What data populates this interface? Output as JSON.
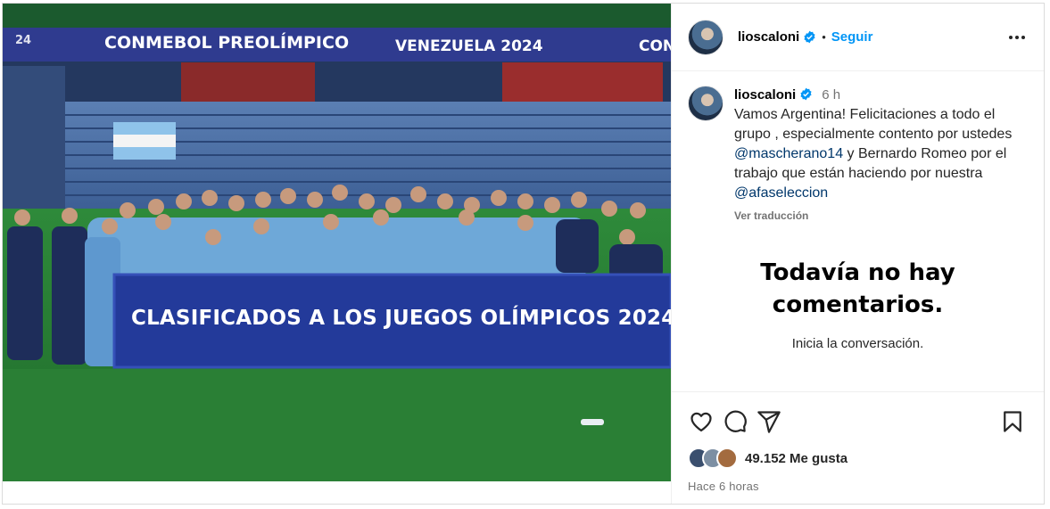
{
  "photo": {
    "top_banner_left": "CONMEBOL PREOLÍMPICO",
    "top_banner_right": "VENEZUELA 2024",
    "top_banner_edge": "CON",
    "top_banner_edge_left": "24",
    "main_banner": "CLASIFICADOS A LOS JUEGOS OLÍMPICOS 2024"
  },
  "header": {
    "username": "lioscaloni",
    "separator": "•",
    "follow_label": "Seguir"
  },
  "caption": {
    "username": "lioscaloni",
    "time": "6 h",
    "text_1": "Vamos Argentina! Felicitaciones a todo el grupo , especialmente contento por ustedes ",
    "mention_1": "@mascherano14",
    "text_2": " y Bernardo Romeo por el trabajo que están haciendo por nuestra ",
    "mention_2": "@afaseleccion",
    "translate_label": "Ver traducción"
  },
  "comments": {
    "empty_title": "Todavía no hay comentarios.",
    "empty_subtitle": "Inicia la conversación."
  },
  "footer": {
    "likes": "49.152 Me gusta",
    "posted": "Hace 6 horas"
  },
  "colors": {
    "accent": "#0095f6",
    "mention": "#00376b",
    "verified": "#0095f6",
    "muted": "#737373"
  }
}
